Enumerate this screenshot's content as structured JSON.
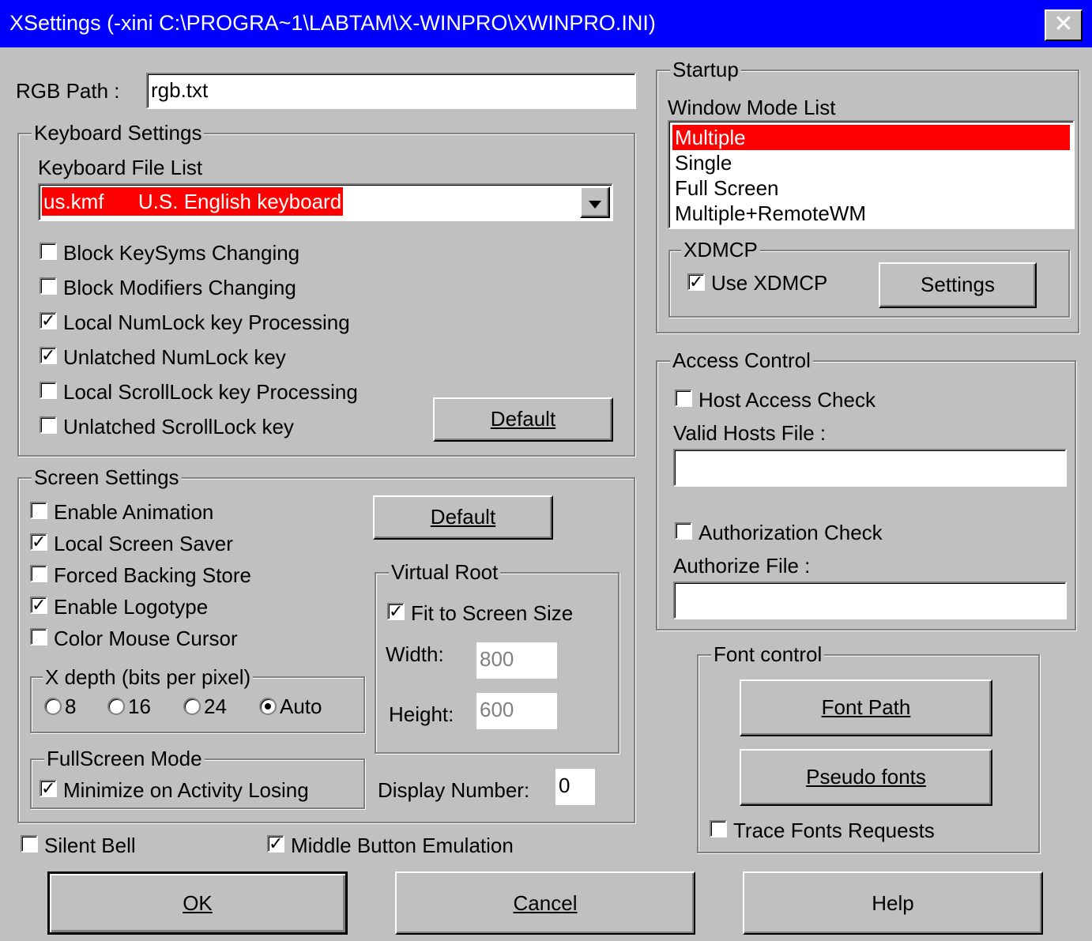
{
  "window": {
    "title": "XSettings (-xini C:\\PROGRA~1\\LABTAM\\X-WINPRO\\XWINPRO.INI)",
    "close_label": "✕"
  },
  "rgb": {
    "label": "RGB Path :",
    "value": "rgb.txt"
  },
  "keyboard": {
    "group_title": "Keyboard Settings",
    "file_list_label": "Keyboard File List",
    "selected_file": "us.kmf      U.S. English keyboard",
    "options": [
      {
        "label": "Block KeySyms Changing",
        "checked": false
      },
      {
        "label": "Block Modifiers Changing",
        "checked": false
      },
      {
        "label": "Local NumLock key Processing",
        "checked": true
      },
      {
        "label": "Unlatched NumLock key",
        "checked": true
      },
      {
        "label": "Local ScrollLock key Processing",
        "checked": false
      },
      {
        "label": "Unlatched ScrollLock key",
        "checked": false
      }
    ],
    "default_label": "Default"
  },
  "screen": {
    "group_title": "Screen Settings",
    "options": [
      {
        "label": "Enable Animation",
        "checked": false
      },
      {
        "label": "Local Screen Saver",
        "checked": true
      },
      {
        "label": "Forced Backing Store",
        "checked": false
      },
      {
        "label": "Enable Logotype",
        "checked": true
      },
      {
        "label": "Color Mouse Cursor",
        "checked": false
      }
    ],
    "default_label": "Default",
    "depth": {
      "title": "X depth (bits per pixel)",
      "options": [
        "8",
        "16",
        "24",
        "Auto"
      ],
      "selected": "Auto"
    },
    "fullscreen": {
      "title": "FullScreen Mode",
      "minimize_label": "Minimize on Activity Losing",
      "minimize_checked": true
    },
    "virtual_root": {
      "title": "Virtual Root",
      "fit_label": "Fit to Screen Size",
      "fit_checked": true,
      "width_label": "Width:",
      "width_value": "800",
      "height_label": "Height:",
      "height_value": "600"
    },
    "display_number_label": "Display Number:",
    "display_number_value": "0"
  },
  "bottom": {
    "silent_bell_label": "Silent Bell",
    "silent_bell_checked": false,
    "middle_button_label": "Middle Button Emulation",
    "middle_button_checked": true,
    "ok_label": "OK",
    "cancel_label": "Cancel",
    "help_label": "Help"
  },
  "startup": {
    "group_title": "Startup",
    "window_mode_label": "Window Mode List",
    "modes": [
      "Multiple",
      "Single",
      "Full Screen",
      "Multiple+RemoteWM"
    ],
    "selected_mode": "Multiple",
    "xdmcp": {
      "title": "XDMCP",
      "use_label": "Use XDMCP",
      "use_checked": true,
      "settings_label": "Settings"
    }
  },
  "access": {
    "group_title": "Access Control",
    "host_check_label": "Host Access Check",
    "host_check_checked": false,
    "valid_hosts_label": "Valid Hosts File :",
    "valid_hosts_value": "",
    "auth_check_label": "Authorization Check",
    "auth_check_checked": false,
    "authorize_file_label": "Authorize File :",
    "authorize_file_value": ""
  },
  "font": {
    "group_title": "Font control",
    "font_path_label": "Font Path",
    "pseudo_fonts_label": "Pseudo fonts",
    "trace_label": "Trace Fonts Requests",
    "trace_checked": false
  },
  "colors": {
    "title_bar": "#0000ff",
    "selection": "#ff0000",
    "face": "#c0c0c0"
  },
  "icons": {
    "dropdown": "chevron-down-icon",
    "check": "checkmark-icon"
  }
}
